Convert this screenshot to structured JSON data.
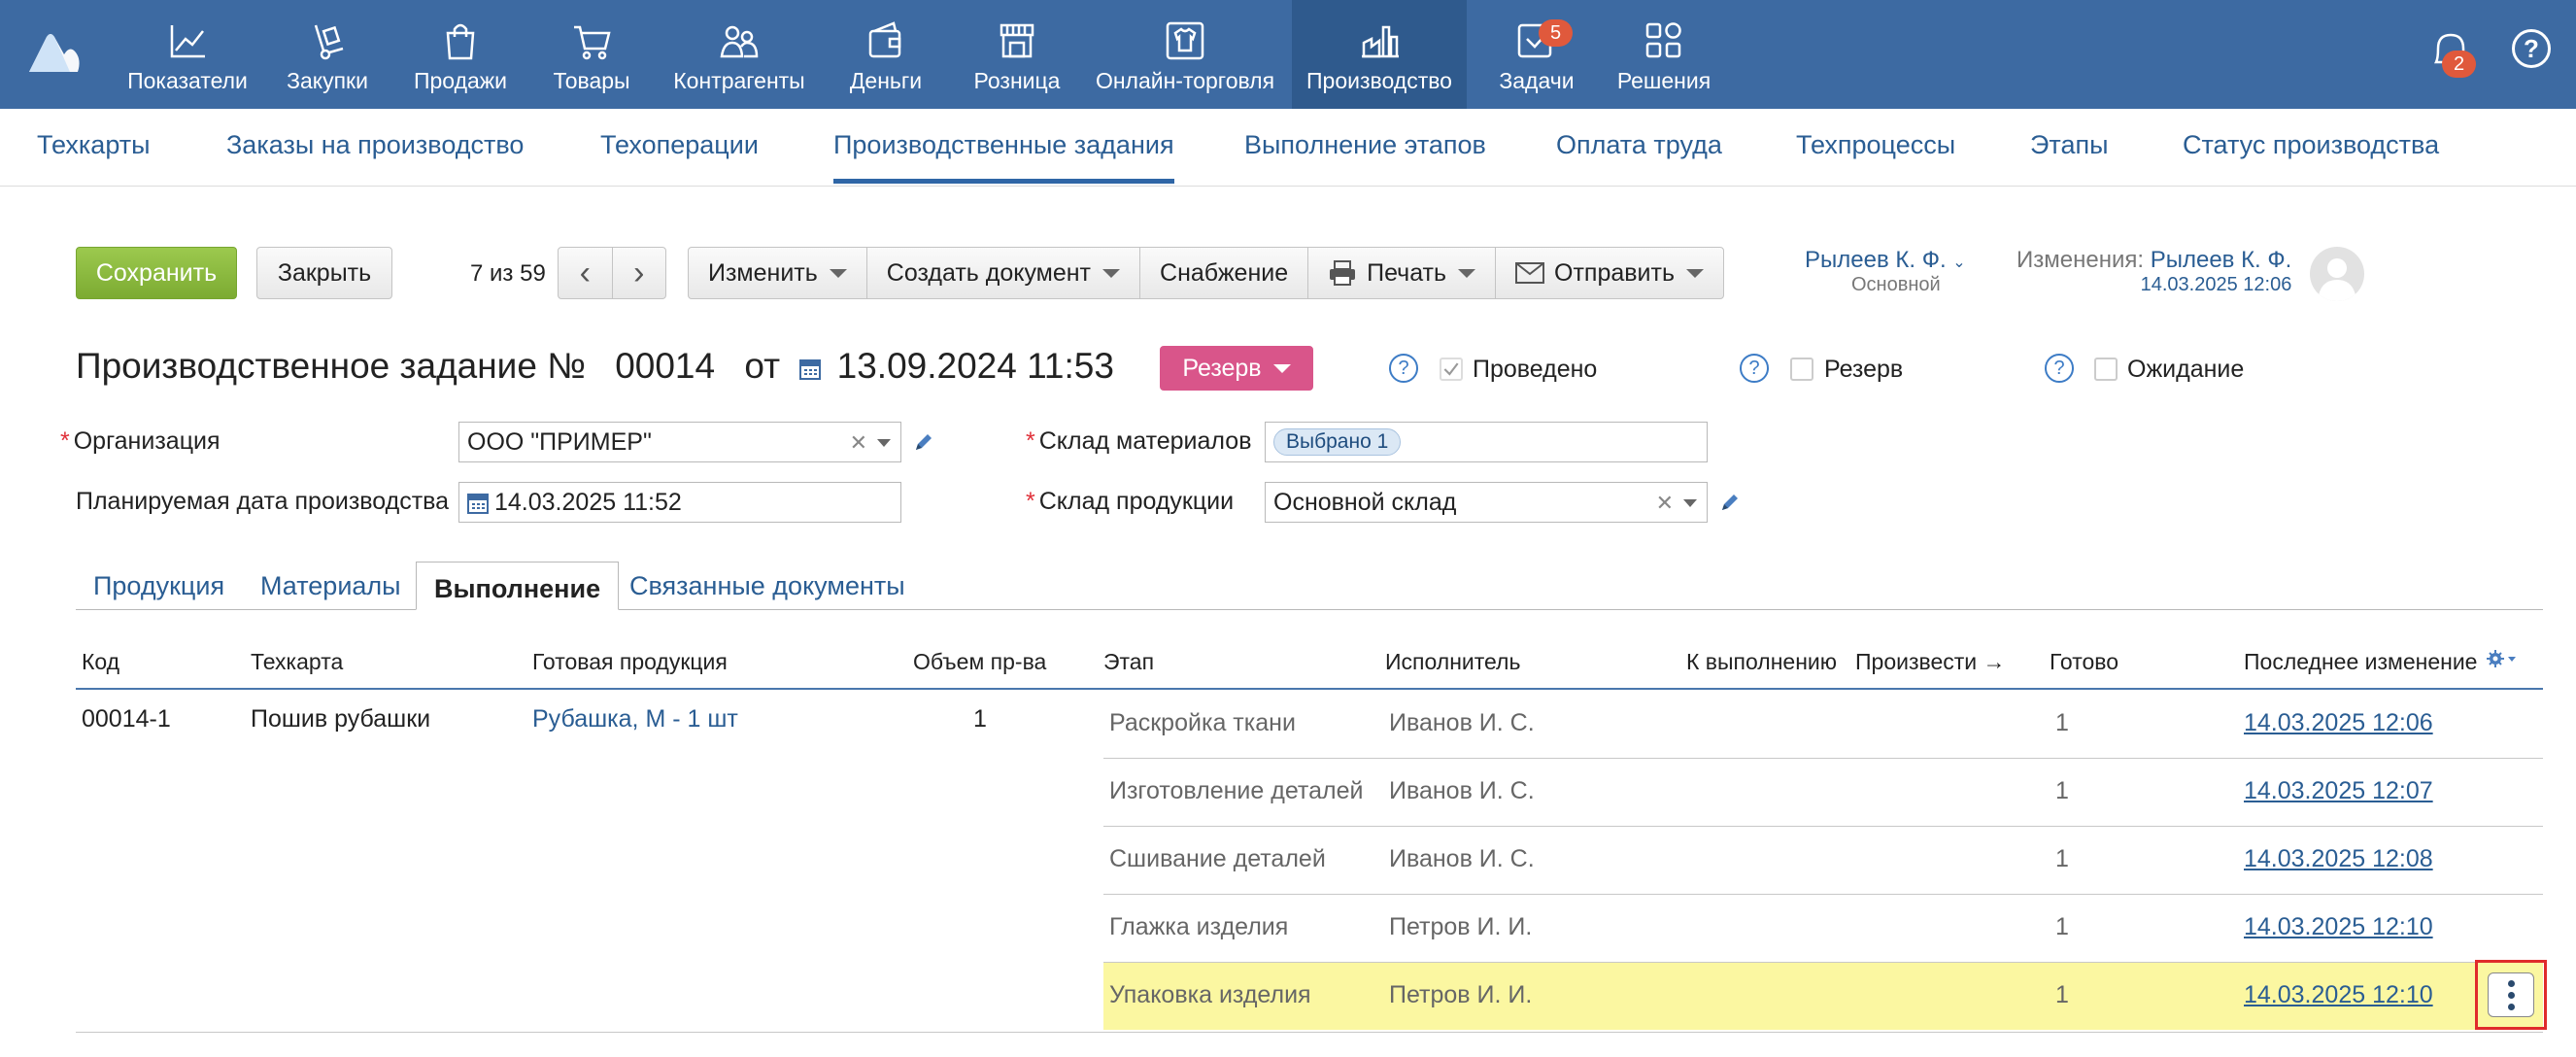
{
  "topnav": {
    "items": [
      {
        "label": "Показатели",
        "icon": "chart-line-icon"
      },
      {
        "label": "Закупки",
        "icon": "dolly-icon"
      },
      {
        "label": "Продажи",
        "icon": "shopping-bag-icon"
      },
      {
        "label": "Товары",
        "icon": "cart-icon"
      },
      {
        "label": "Контрагенты",
        "icon": "people-icon"
      },
      {
        "label": "Деньги",
        "icon": "wallet-icon"
      },
      {
        "label": "Розница",
        "icon": "store-icon"
      },
      {
        "label": "Онлайн-торговля",
        "icon": "shirt-icon"
      },
      {
        "label": "Производство",
        "icon": "factory-icon"
      },
      {
        "label": "Задачи",
        "icon": "tasks-check-icon",
        "badge": "5"
      },
      {
        "label": "Решения",
        "icon": "apps-grid-icon"
      }
    ],
    "notifications_badge": "2",
    "help": "?"
  },
  "subnav": {
    "items": [
      "Техкарты",
      "Заказы на производство",
      "Техоперации",
      "Производственные задания",
      "Выполнение этапов",
      "Оплата труда",
      "Техпроцессы",
      "Этапы",
      "Статус производства"
    ],
    "active": "Производственные задания"
  },
  "toolbar": {
    "save": "Сохранить",
    "close": "Закрыть",
    "counter": "7 из 59",
    "prev": "‹",
    "next": "›",
    "change": "Изменить",
    "create_doc": "Создать документ",
    "supply": "Снабжение",
    "print": "Печать",
    "send": "Отправить"
  },
  "user": {
    "name": "Рылеев К. Ф.",
    "role": "Основной",
    "changes_label": "Изменения:",
    "changes_user": "Рылеев К. Ф.",
    "changes_date": "14.03.2025 12:06"
  },
  "doc": {
    "title_prefix": "Производственное задание №",
    "number": "00014",
    "from": "от",
    "date": "13.09.2024 11:53",
    "status": "Резерв",
    "posted_label": "Проведено",
    "reserve_label": "Резерв",
    "waiting_label": "Ожидание"
  },
  "form": {
    "org_label": "Организация",
    "org_value": "ООО \"ПРИМЕР\"",
    "plan_date_label": "Планируемая дата производства",
    "plan_date_value": "14.03.2025 11:52",
    "materials_wh_label": "Склад материалов",
    "materials_wh_value": "Выбрано 1",
    "products_wh_label": "Склад продукции",
    "products_wh_value": "Основной склад"
  },
  "tabs": [
    "Продукция",
    "Материалы",
    "Выполнение",
    "Связанные документы"
  ],
  "table": {
    "headers": {
      "code": "Код",
      "techcard": "Техкарта",
      "product": "Готовая продукция",
      "volume": "Объем пр-ва",
      "stage": "Этап",
      "executor": "Исполнитель",
      "to_do": "К выполнению",
      "produce": "Произвести →",
      "done": "Готово",
      "last_change": "Последнее изменение"
    },
    "main_row": {
      "code": "00014-1",
      "techcard": "Пошив рубашки",
      "product": "Рубашка, M - 1 шт",
      "volume": "1"
    },
    "stages": [
      {
        "stage": "Раскройка ткани",
        "executor": "Иванов И. С.",
        "done": "1",
        "date": "14.03.2025 12:06"
      },
      {
        "stage": "Изготовление деталей",
        "executor": "Иванов И. С.",
        "done": "1",
        "date": "14.03.2025 12:07"
      },
      {
        "stage": "Сшивание деталей",
        "executor": "Иванов И. С.",
        "done": "1",
        "date": "14.03.2025 12:08"
      },
      {
        "stage": "Глажка изделия",
        "executor": "Петров И. И.",
        "done": "1",
        "date": "14.03.2025 12:10"
      },
      {
        "stage": "Упаковка изделия",
        "executor": "Петров И. И.",
        "done": "1",
        "date": "14.03.2025 12:10"
      }
    ]
  }
}
